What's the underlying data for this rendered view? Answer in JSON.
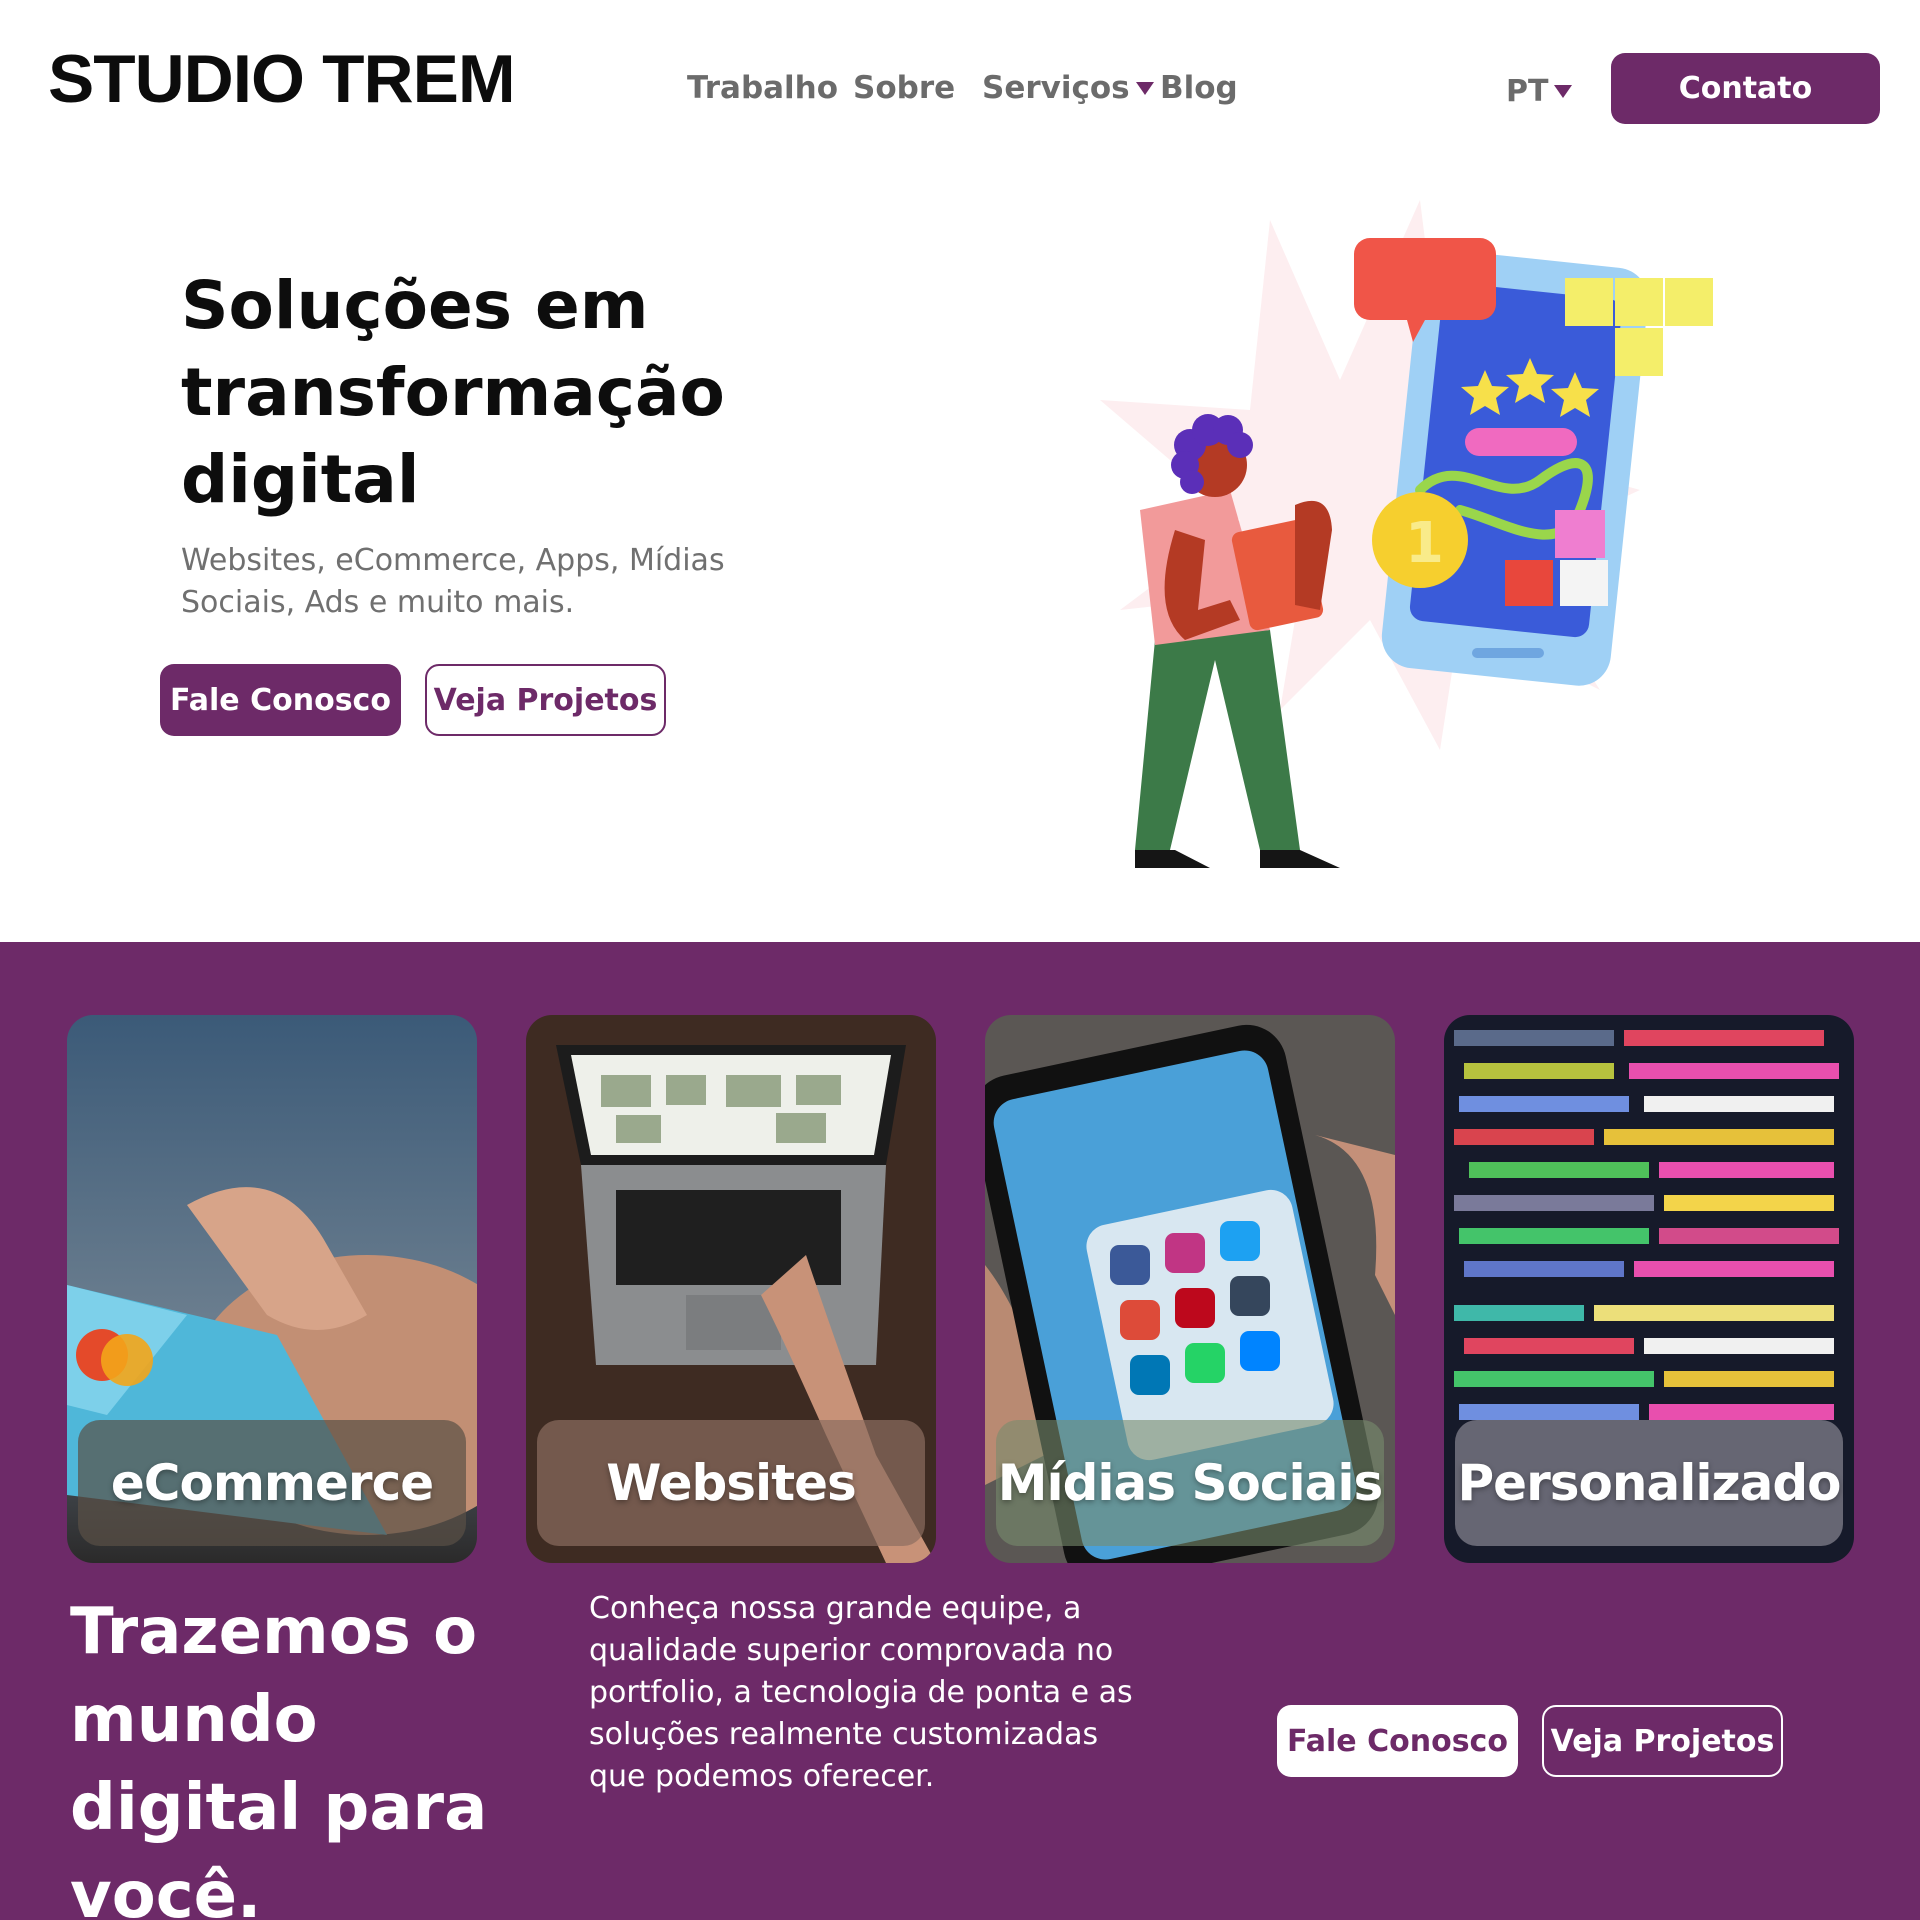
{
  "brand": {
    "logo": "STUDIO TREM",
    "accent_color": "#6d2a68"
  },
  "nav": {
    "items": [
      {
        "label": "Trabalho"
      },
      {
        "label": "Sobre"
      },
      {
        "label": "Serviços",
        "dropdown_icon": "caret-down-icon"
      },
      {
        "label": "Blog"
      }
    ],
    "language": "PT",
    "contact_button": "Contato"
  },
  "hero": {
    "title": "Soluções em transformação digital",
    "subtitle": "Websites, eCommerce, Apps, Mídias Sociais, Ads e muito mais.",
    "primary_button": "Fale Conosco",
    "secondary_button": "Veja Projetos",
    "illustration": "person-holding-book-with-phone-illustration"
  },
  "services": {
    "cards": [
      {
        "label": "eCommerce",
        "image": "credit-card-photo"
      },
      {
        "label": "Websites",
        "image": "laptop-photo"
      },
      {
        "label": "Mídias Sociais",
        "image": "phone-social-apps-photo"
      },
      {
        "label": "Personalizado",
        "image": "code-screen-photo"
      }
    ]
  },
  "about": {
    "title": "Trazemos o mundo digital para você.",
    "text": "Conheça nossa grande equipe, a qualidade superior comprovada no portfolio, a tecnologia de ponta e as soluções realmente customizadas que podemos oferecer.",
    "primary_button": "Fale Conosco",
    "secondary_button": "Veja Projetos"
  }
}
